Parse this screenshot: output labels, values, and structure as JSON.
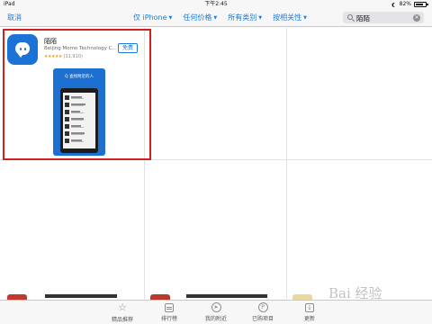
{
  "status_bar": {
    "device": "iPad",
    "time": "下午2:45",
    "battery": "82%",
    "battery_level": 0.82
  },
  "nav": {
    "cancel_label": "取消",
    "filters": [
      {
        "label": "仅 iPhone"
      },
      {
        "label": "任何价格"
      },
      {
        "label": "所有类别"
      },
      {
        "label": "按相关性"
      }
    ],
    "search": {
      "query": "陌陌"
    }
  },
  "app": {
    "name": "陌陌",
    "developer": "Beijing Momo Technology C...",
    "stars": "★★★★★",
    "rating_count": "(11,910)",
    "get_label": "免费",
    "screenshot_caption": "Q 查找附近的人"
  },
  "tab_bar": {
    "tabs": [
      {
        "label": "精品推荐",
        "icon": "star-icon"
      },
      {
        "label": "排行榜",
        "icon": "list-icon"
      },
      {
        "label": "我的附近",
        "icon": "location-icon"
      },
      {
        "label": "已购项目",
        "icon": "purchased-icon"
      },
      {
        "label": "更新",
        "icon": "download-icon"
      }
    ]
  },
  "watermark": "Bai 经验",
  "colors": {
    "accent": "#1a7ae0",
    "highlight": "#d21f1f",
    "app_icon": "#1d72d6"
  }
}
